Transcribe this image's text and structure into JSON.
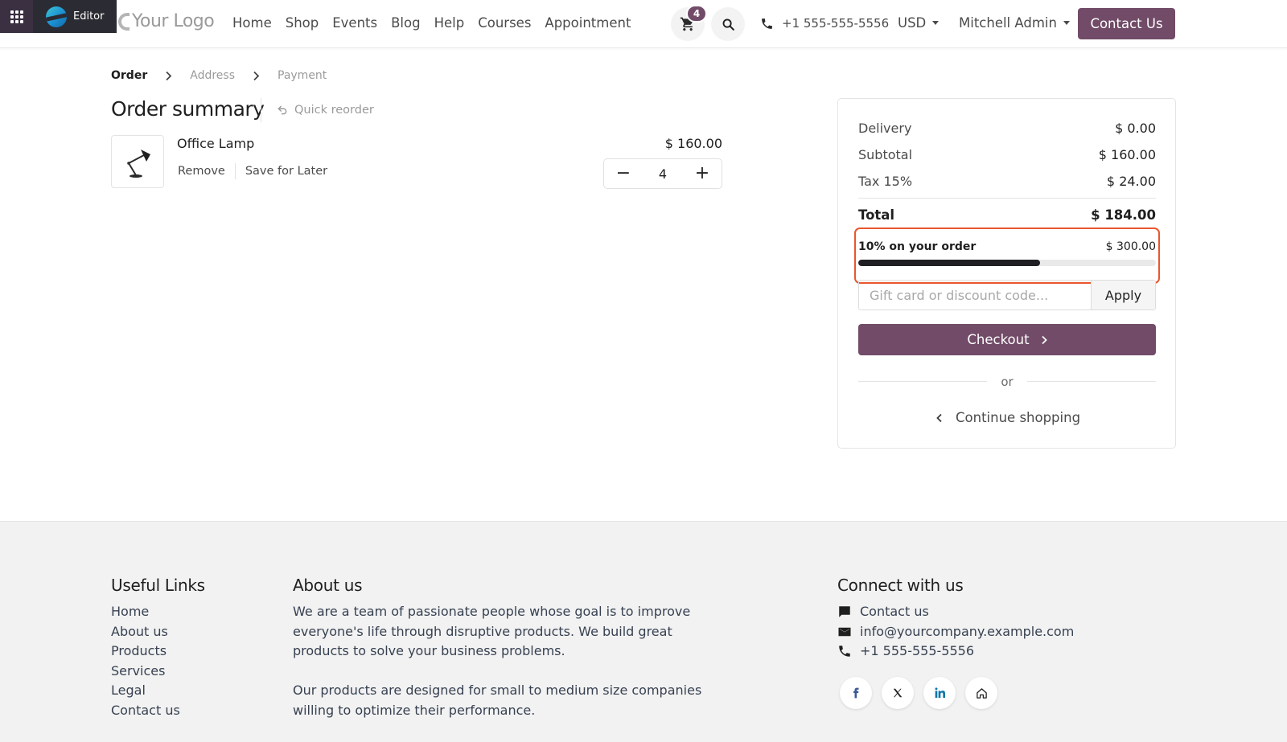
{
  "toolbar": {
    "editor_label": "Editor"
  },
  "header": {
    "logo": "Your Logo",
    "nav": [
      "Home",
      "Shop",
      "Events",
      "Blog",
      "Help",
      "Courses",
      "Appointment"
    ],
    "cart_count": "4",
    "phone": "+1 555-555-5556",
    "currency": "USD",
    "user": "Mitchell Admin",
    "contact_label": "Contact Us"
  },
  "breadcrumb": {
    "step1": "Order",
    "step2": "Address",
    "step3": "Payment"
  },
  "order": {
    "title": "Order summary",
    "quick_reorder": "Quick reorder",
    "item": {
      "name": "Office Lamp",
      "remove": "Remove",
      "save_later": "Save for Later",
      "price": "$ 160.00",
      "quantity": "4"
    }
  },
  "summary": {
    "delivery_label": "Delivery",
    "delivery_value": "$ 0.00",
    "subtotal_label": "Subtotal",
    "subtotal_value": "$ 160.00",
    "tax_label": "Tax 15%",
    "tax_value": "$ 24.00",
    "total_label": "Total",
    "total_value": "$ 184.00",
    "promo_label": "10% on your order",
    "promo_amount": "$ 300.00",
    "promo_progress": 0.61,
    "code_placeholder": "Gift card or discount code...",
    "apply_label": "Apply",
    "checkout_label": "Checkout",
    "or_label": "or",
    "continue_label": "Continue shopping"
  },
  "footer": {
    "useful_title": "Useful Links",
    "useful_links": [
      "Home",
      "About us",
      "Products",
      "Services",
      "Legal",
      "Contact us"
    ],
    "about_title": "About us",
    "about_p1": "We are a team of passionate people whose goal is to improve everyone's life through disruptive products. We build great products to solve your business problems.",
    "about_p2": "Our products are designed for small to medium size companies willing to optimize their performance.",
    "connect_title": "Connect with us",
    "contact_us": "Contact us",
    "email": "info@yourcompany.example.com",
    "phone": "+1 555-555-5556"
  },
  "colors": {
    "brand": "#714b67",
    "highlight": "#e8562f",
    "apps_bg": "#3b3042",
    "editor_bg": "#2b2b33"
  }
}
